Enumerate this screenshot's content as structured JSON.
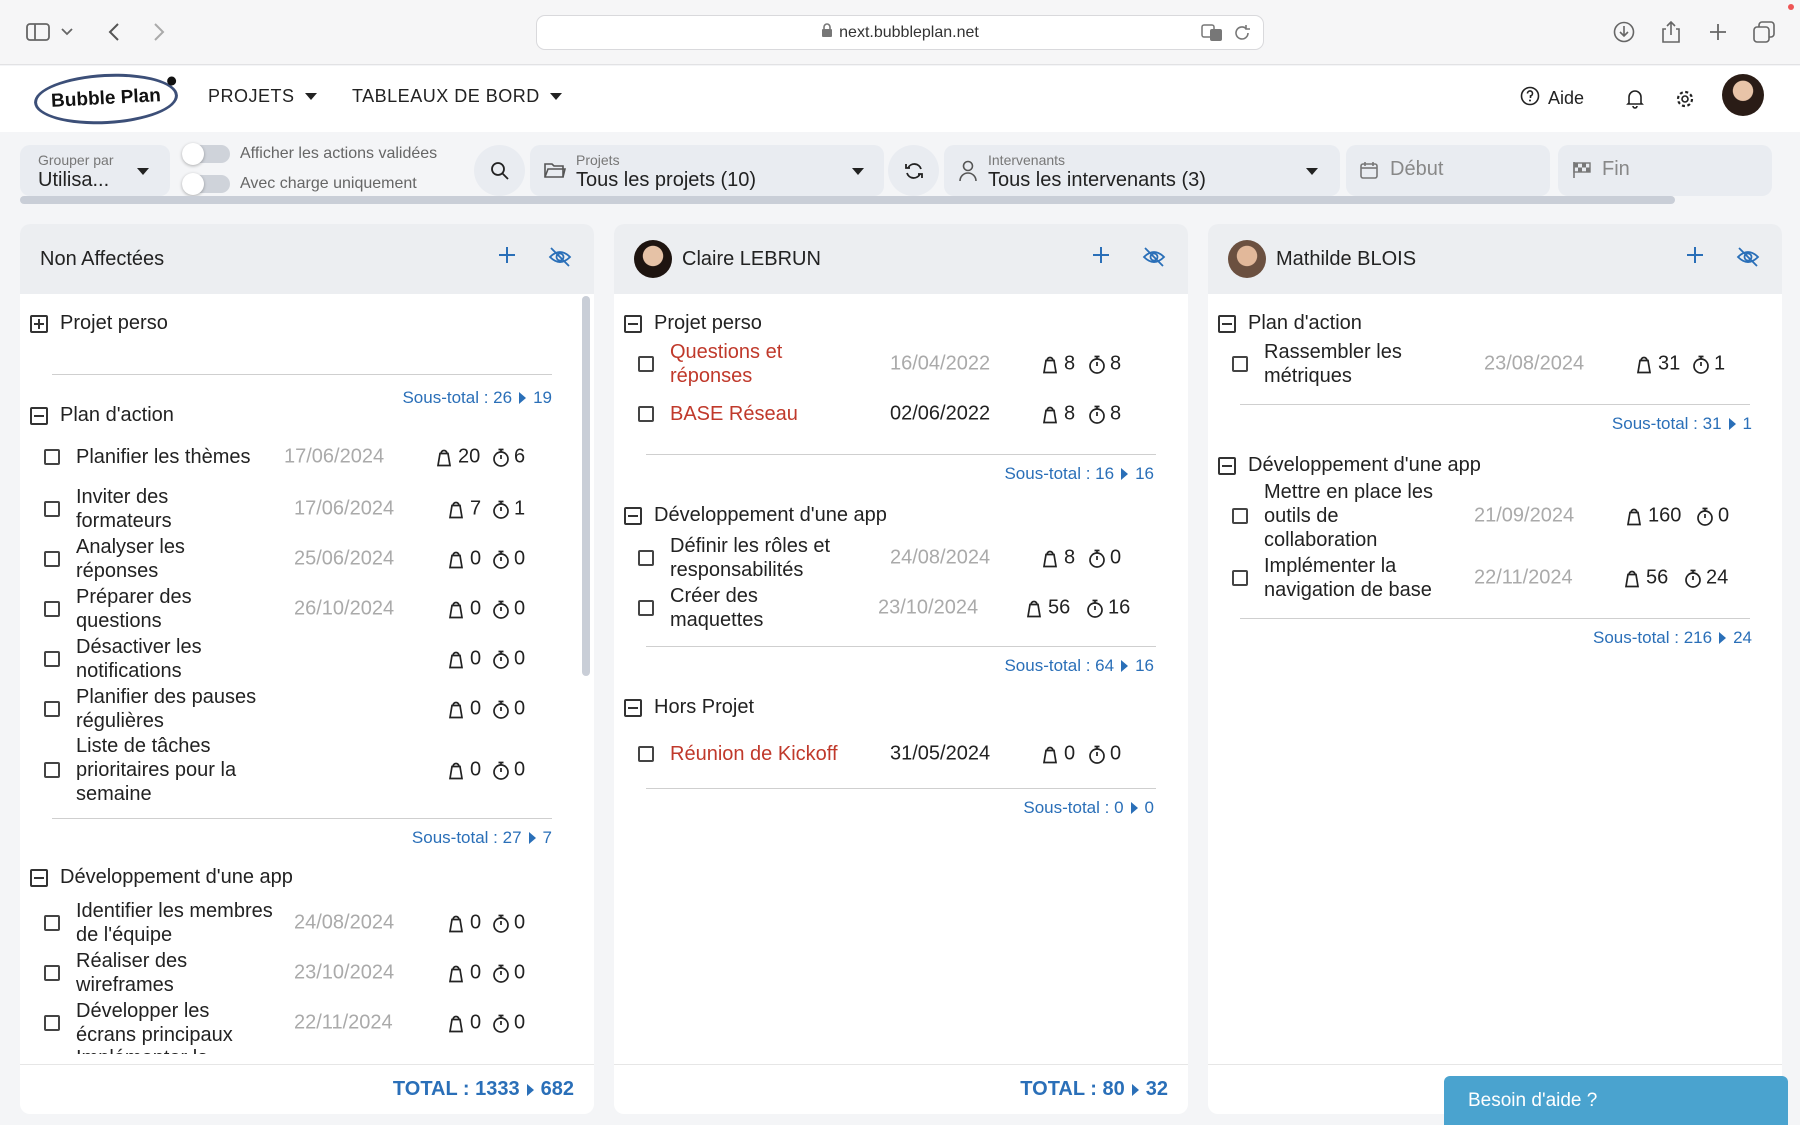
{
  "browser": {
    "url": "next.bubbleplan.net"
  },
  "header": {
    "logo": "Bubble Plan",
    "nav": [
      "PROJETS",
      "TABLEAUX DE BORD"
    ],
    "help": "Aide"
  },
  "filters": {
    "group_label": "Grouper par",
    "group_value": "Utilisa...",
    "toggle1": "Afficher les actions validées",
    "toggle2": "Avec charge uniquement",
    "projects_label": "Projets",
    "projects_value": "Tous les projets (10)",
    "people_label": "Intervenants",
    "people_value": "Tous les intervenants (3)",
    "start_placeholder": "Début",
    "end_placeholder": "Fin"
  },
  "columns": [
    {
      "title": "Non Affectées",
      "total": "TOTAL : 1333",
      "total2": "682",
      "groups": [
        {
          "name": "Projet perso",
          "collapsed": true,
          "subtotal": "Sous-total : 26",
          "subtotal2": "19",
          "tasks": []
        },
        {
          "name": "Plan d'action",
          "subtotal": "Sous-total : 27",
          "subtotal2": "7",
          "tasks": [
            {
              "name": "Planifier les thèmes",
              "date": "17/06/2024",
              "load": "20",
              "time": "6"
            },
            {
              "name": "Inviter des formateurs",
              "date": "17/06/2024",
              "load": "7",
              "time": "1"
            },
            {
              "name": "Analyser les réponses",
              "date": "25/06/2024",
              "load": "0",
              "time": "0"
            },
            {
              "name": "Préparer des questions",
              "date": "26/10/2024",
              "load": "0",
              "time": "0"
            },
            {
              "name": "Désactiver les notifications",
              "date": "",
              "load": "0",
              "time": "0"
            },
            {
              "name": "Planifier des pauses régulières",
              "date": "",
              "load": "0",
              "time": "0"
            },
            {
              "name": "Liste de tâches prioritaires pour la semaine",
              "date": "",
              "load": "0",
              "time": "0"
            }
          ]
        },
        {
          "name": "Développement d'une app",
          "tasks": [
            {
              "name": "Identifier les membres de l'équipe",
              "date": "24/08/2024",
              "load": "0",
              "time": "0"
            },
            {
              "name": "Réaliser des wireframes",
              "date": "23/10/2024",
              "load": "0",
              "time": "0"
            },
            {
              "name": "Développer les écrans principaux",
              "date": "22/11/2024",
              "load": "0",
              "time": "0"
            },
            {
              "name": "Implémenter la",
              "date": "",
              "load": "",
              "time": ""
            }
          ]
        }
      ]
    },
    {
      "title": "Claire LEBRUN",
      "total": "TOTAL : 80",
      "total2": "32",
      "groups": [
        {
          "name": "Projet perso",
          "subtotal": "Sous-total : 16",
          "subtotal2": "16",
          "tasks": [
            {
              "name": "Questions et réponses",
              "date": "16/04/2022",
              "load": "8",
              "time": "8"
            },
            {
              "name": "BASE Réseau",
              "date": "02/06/2022",
              "load": "8",
              "time": "8"
            }
          ]
        },
        {
          "name": "Développement d'une app",
          "subtotal": "Sous-total : 64",
          "subtotal2": "16",
          "tasks": [
            {
              "name": "Définir les rôles et responsabilités",
              "date": "24/08/2024",
              "load": "8",
              "time": "0"
            },
            {
              "name": "Créer des maquettes",
              "date": "23/10/2024",
              "load": "56",
              "time": "16"
            }
          ]
        },
        {
          "name": "Hors Projet",
          "subtotal": "Sous-total : 0",
          "subtotal2": "0",
          "tasks": [
            {
              "name": "Réunion de Kickoff",
              "date": "31/05/2024",
              "load": "0",
              "time": "0"
            }
          ]
        }
      ]
    },
    {
      "title": "Mathilde BLOIS",
      "groups": [
        {
          "name": "Plan d'action",
          "subtotal": "Sous-total : 31",
          "subtotal2": "1",
          "tasks": [
            {
              "name": "Rassembler les métriques",
              "date": "23/08/2024",
              "load": "31",
              "time": "1"
            }
          ]
        },
        {
          "name": "Développement d'une app",
          "subtotal": "Sous-total : 216",
          "subtotal2": "24",
          "tasks": [
            {
              "name": "Mettre en place les outils de collaboration",
              "date": "21/09/2024",
              "load": "160",
              "time": "0"
            },
            {
              "name": "Implémenter la navigation de base",
              "date": "22/11/2024",
              "load": "56",
              "time": "24"
            }
          ]
        }
      ]
    }
  ],
  "help_widget": "Besoin d'aide ?",
  "colors": {
    "accent": "#2a6fb8",
    "overdue": "#c0392b",
    "header_bg": "#eceef1"
  }
}
